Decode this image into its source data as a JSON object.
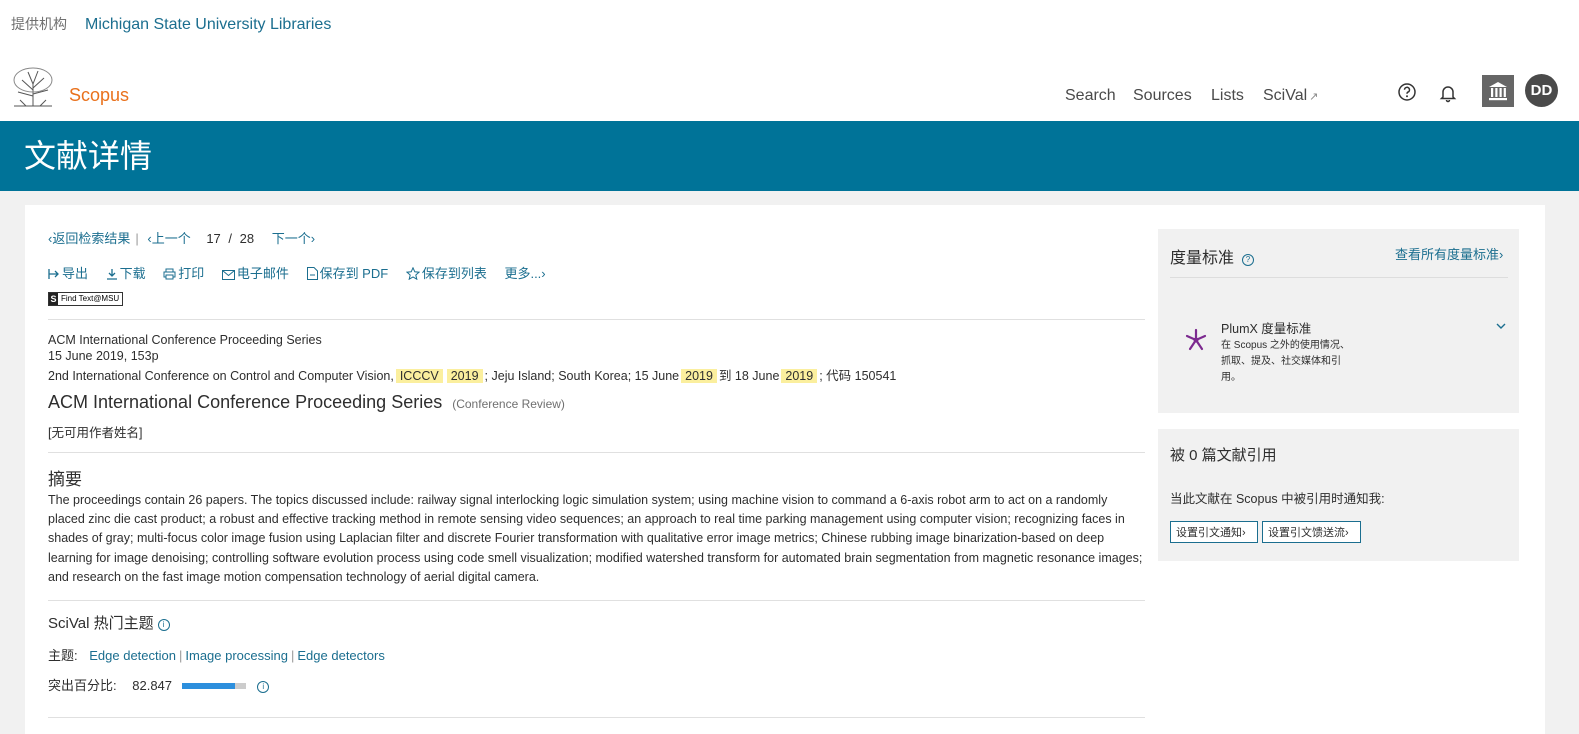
{
  "header": {
    "institution_label": "提供机构",
    "institution_name": "Michigan State University Libraries",
    "brand": "Scopus",
    "nav": {
      "search": "Search",
      "sources": "Sources",
      "lists": "Lists",
      "scival": "SciVal",
      "scival_ext": "↗"
    },
    "avatar_initials": "DD",
    "colors": {
      "brand": "#e9711c",
      "banner": "#007398",
      "link": "#1b6e8f"
    }
  },
  "banner": {
    "title": "文献详情"
  },
  "navigation": {
    "back": "‹返回检索结果",
    "prev": "‹上一个",
    "current": "17",
    "slash": "/",
    "total": "28",
    "next": "下一个›"
  },
  "toolbar": {
    "export": "导出",
    "download": "下载",
    "print": "打印",
    "email": "电子邮件",
    "save_pdf": "保存到 PDF",
    "save_list": "保存到列表",
    "more": "更多...›",
    "findtext": "Find Text@MSU"
  },
  "source": {
    "series": "ACM International Conference Proceeding Series",
    "date_pages": "15 June 2019, 153p",
    "conf_prefix": "2nd International Conference on Control and Computer Vision,",
    "conf_acronym": "ICCCV",
    "conf_year": "2019",
    "conf_location": "; Jeju Island; South Korea; 15 June",
    "conf_start_year": "2019",
    "conf_to": "到 18 June",
    "conf_end_year": "2019",
    "conf_code": "; 代码 150541"
  },
  "document": {
    "title": "ACM International Conference Proceeding Series",
    "type": "(Conference Review)",
    "authors": "[无可用作者姓名]"
  },
  "abstract": {
    "heading": "摘要",
    "text": "The proceedings contain 26 papers. The topics discussed include: railway signal interlocking logic simulation system; using machine vision to command a 6-axis robot arm to act on a randomly placed zinc die cast product; a robust and effective tracking method in remote sensing video sequences; an approach to real time parking management using computer vision; recognizing faces in shades of gray; multi-focus color image fusion using Laplacian filter and discrete Fourier transformation with qualitative error image metrics; Chinese rubbing image binarization-based on deep learning for image denoising; controlling software evolution process using code smell visualization; modified watershed transform for automated brain segmentation from magnetic resonance images; and research on the fast image motion compensation technology of aerial digital camera."
  },
  "scival": {
    "heading": "SciVal 热门主题",
    "topics_label": "主题:",
    "topics": [
      "Edge detection",
      "Image processing",
      "Edge detectors"
    ],
    "topic_sep": "|",
    "percentile_label": "突出百分比:",
    "percentile_value": "82.847",
    "percentile_fraction": 0.828
  },
  "metrics": {
    "title": "度量标准",
    "view_all": "查看所有度量标准›",
    "plumx_title": "PlumX 度量标准",
    "plumx_desc": "在 Scopus 之外的使用情况、抓取、提及、社交媒体和引用。"
  },
  "citations": {
    "title": "被 0 篇文献引用",
    "notice": "当此文献在 Scopus 中被引用时通知我:",
    "btn_alert": "设置引文通知›",
    "btn_feed": "设置引文馈送流›"
  }
}
